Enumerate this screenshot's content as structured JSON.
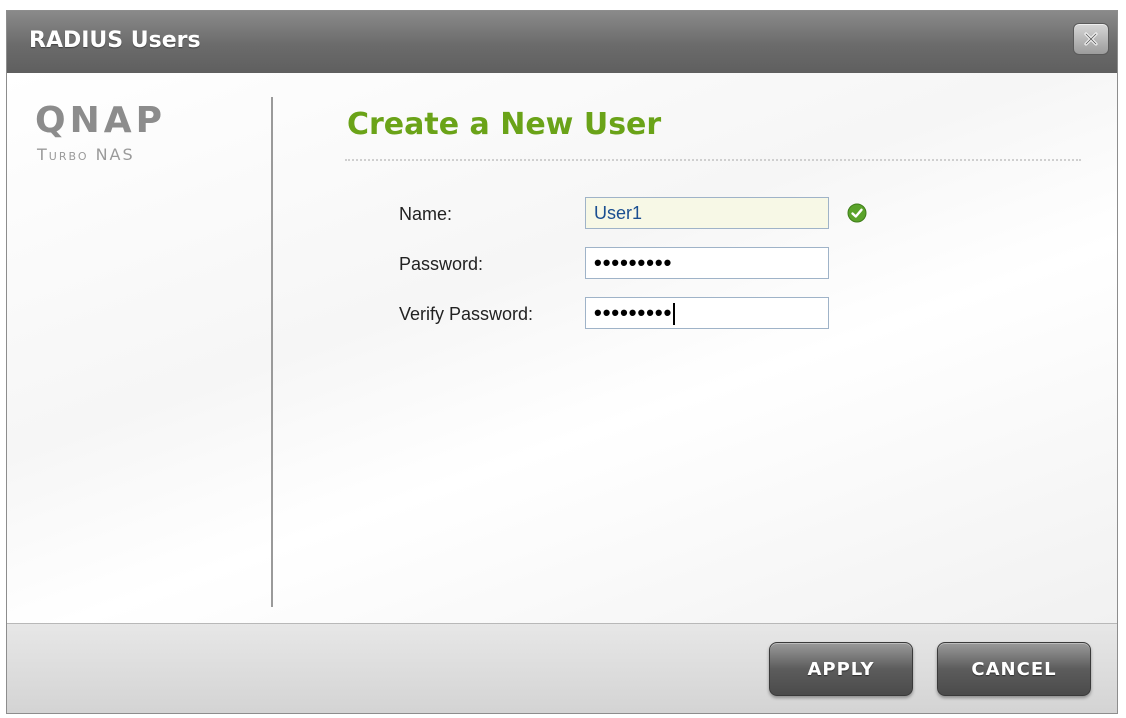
{
  "window": {
    "title": "RADIUS Users",
    "close_icon": "close-icon"
  },
  "brand": {
    "logo": "QNAP",
    "subtitle": "Turbo NAS"
  },
  "form": {
    "heading": "Create a New User",
    "name_label": "Name:",
    "name_value": "User1",
    "name_status_icon": "check-circle-icon",
    "password_label": "Password:",
    "password_mask": "•••••••••",
    "verify_label": "Verify Password:",
    "verify_mask": "•••••••••"
  },
  "buttons": {
    "apply": "APPLY",
    "cancel": "CANCEL"
  },
  "colors": {
    "heading": "#6aa318",
    "titlebar": "#6b6b6b",
    "check": "#5aa32a"
  }
}
